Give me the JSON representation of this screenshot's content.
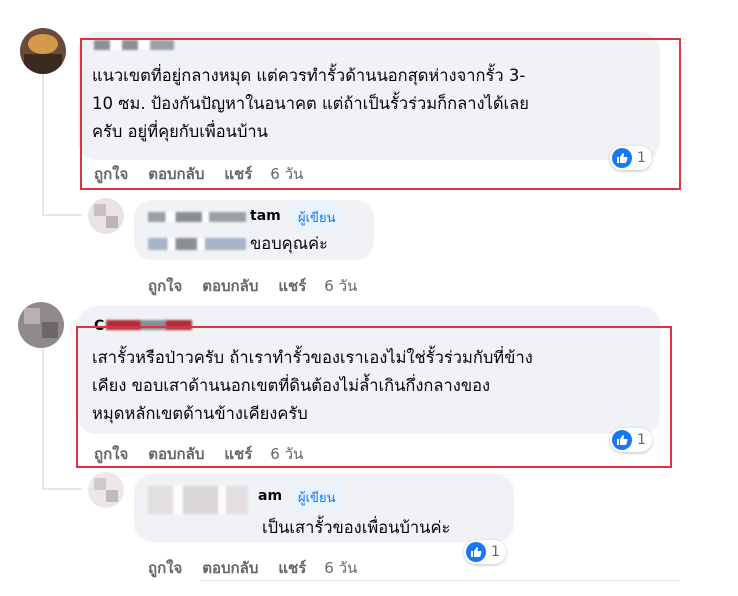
{
  "actions": {
    "like": "ถูกใจ",
    "reply": "ตอบกลับ",
    "share": "แชร์"
  },
  "comments": [
    {
      "name_visible": "",
      "lines": [
        "แนวเขตที่อยู่กลางหมุด แต่ควรทำรั้วด้านนอกสุดห่างจากรั้ว 3-",
        "10 ซม. ป้องกันปัญหาในอนาคต แต่ถ้าเป็นรั้วร่วมก็กลางได้เลย",
        "ครับ อยู่ที่คุยกับเพื่อนบ้าน"
      ],
      "time": "6 วัน",
      "reactions": "1"
    },
    {
      "name_visible": "tam",
      "badge": "ผู้เขียน",
      "lines": [
        "ขอบคุณค่ะ"
      ],
      "time": "6 วัน"
    },
    {
      "name_visible": "C",
      "lines": [
        "เสารั้วหรือป่าวครับ ถ้าเราทำรั้วของเราเองไม่ใช่รั้วร่วมกับที่ข้าง",
        "เคียง ขอบเสาด้านนอกเขตที่ดินต้องไม่ล้ำเกินกึ่งกลางของ",
        "หมุดหลักเขตด้านข้างเคียงครับ"
      ],
      "time": "6 วัน",
      "reactions": "1"
    },
    {
      "name_visible": "am",
      "badge": "ผู้เขียน",
      "lines": [
        "เป็นเสารั้วของเพื่อนบ้านค่ะ"
      ],
      "time": "6 วัน",
      "reactions": "1"
    }
  ],
  "colors": {
    "highlight": "#d9343f",
    "like_blue": "#1877f2",
    "bubble": "#f0f2f5",
    "meta": "#65676b"
  },
  "icons": {
    "like": "thumbs-up-icon"
  }
}
